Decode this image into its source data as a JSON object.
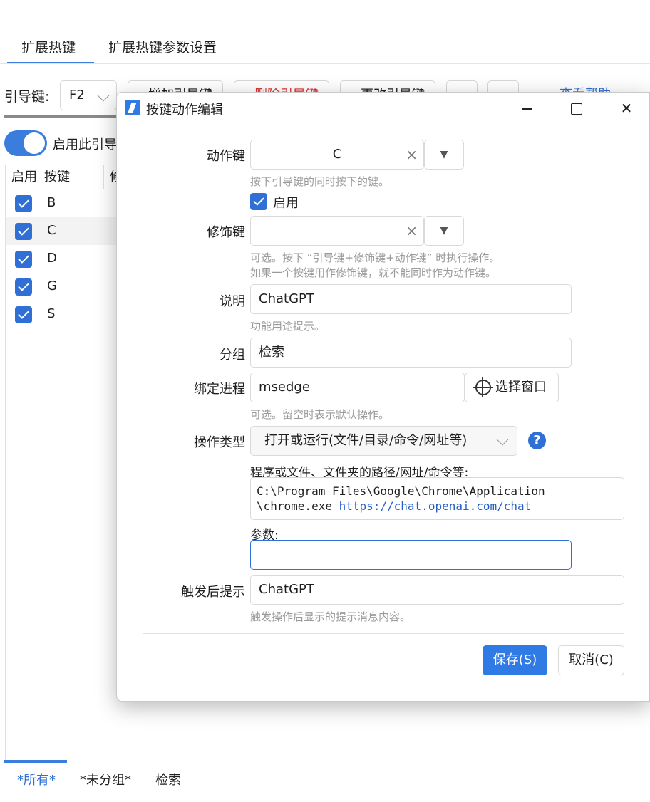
{
  "main_tabs": [
    "扩展热键",
    "扩展热键参数设置"
  ],
  "toolbar": {
    "lead_label": "引导键:",
    "lead_value": "F2",
    "btn_add": "增加引导键",
    "btn_delete": "删除引导键",
    "btn_rename": "更改引导键",
    "help_link": "查看帮助"
  },
  "enable_toggle_label": "启用此引导键",
  "list": {
    "headers": [
      "启用",
      "按键",
      "修"
    ],
    "rows": [
      {
        "key": "B",
        "enabled": true
      },
      {
        "key": "C",
        "enabled": true
      },
      {
        "key": "D",
        "enabled": true
      },
      {
        "key": "G",
        "enabled": true
      },
      {
        "key": "S",
        "enabled": true
      }
    ]
  },
  "bottom_tabs": [
    "*所有*",
    "*未分组*",
    "检索"
  ],
  "dialog": {
    "title": "按键动作编辑",
    "action_key": {
      "label": "动作键",
      "value": "C",
      "hint": "按下引导键的同时按下的键。"
    },
    "enable_label": "启用",
    "modifier": {
      "label": "修饰键",
      "value": "",
      "hint1": "可选。按下 “引导键+修饰键+动作键” 时执行操作。",
      "hint2": "如果一个按键用作修饰键，就不能同时作为动作键。"
    },
    "description": {
      "label": "说明",
      "value": "ChatGPT",
      "hint": "功能用途提示。"
    },
    "group": {
      "label": "分组",
      "value": "检索"
    },
    "bind_process": {
      "label": "绑定进程",
      "value": "msedge",
      "pick_button": "选择窗口",
      "hint": "可选。留空时表示默认操作。"
    },
    "op_type": {
      "label": "操作类型",
      "value": "打开或运行(文件/目录/命令/网址等)"
    },
    "path_label": "程序或文件、文件夹的路径/网址/命令等:",
    "path_line1": "C:\\Program Files\\Google\\Chrome\\Application",
    "path_line2": "\\chrome.exe ",
    "path_link": "https://chat.openai.com/chat",
    "params_label": "参数:",
    "params_value": "",
    "notify": {
      "label": "触发后提示",
      "value": "ChatGPT",
      "hint": "触发操作后显示的提示消息内容。"
    },
    "save_button": "保存(S)",
    "cancel_button": "取消(C)"
  }
}
